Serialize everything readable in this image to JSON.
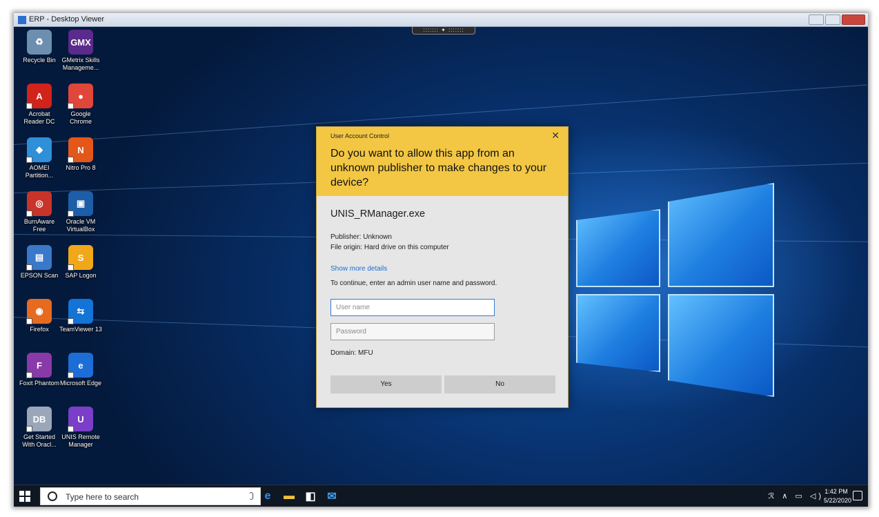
{
  "window": {
    "title": "ERP - Desktop Viewer",
    "connection_bar": "::::::: ✦ :::::::"
  },
  "desktop": {
    "icons": [
      {
        "name": "recycle-bin",
        "icon": "recycle-bin-icon",
        "label": "Recycle Bin",
        "glyph": "♻",
        "color": "#6c8fb0"
      },
      {
        "name": "gmetrix",
        "icon": "gmetrix-icon",
        "label": "GMetrix Skills Manageme...",
        "glyph": "GMX",
        "color": "#5a2a8c"
      },
      {
        "name": "acrobat",
        "icon": "acrobat-icon",
        "label": "Acrobat Reader DC",
        "glyph": "A",
        "color": "#d2231b"
      },
      {
        "name": "chrome",
        "icon": "chrome-icon",
        "label": "Google Chrome",
        "glyph": "●",
        "color": "#e0473a"
      },
      {
        "name": "aomei",
        "icon": "aomei-icon",
        "label": "AOMEI Partition...",
        "glyph": "◆",
        "color": "#2f8fd8"
      },
      {
        "name": "nitro",
        "icon": "nitro-icon",
        "label": "Nitro Pro 8",
        "glyph": "N",
        "color": "#e3571a"
      },
      {
        "name": "burnaware",
        "icon": "burnaware-icon",
        "label": "BurnAware Free",
        "glyph": "◎",
        "color": "#c8332a"
      },
      {
        "name": "virtualbox",
        "icon": "virtualbox-icon",
        "label": "Oracle VM VirtualBox",
        "glyph": "▣",
        "color": "#1d5ea8"
      },
      {
        "name": "epson-scan",
        "icon": "epson-scan-icon",
        "label": "EPSON Scan",
        "glyph": "▤",
        "color": "#3a78c9"
      },
      {
        "name": "sap-logon",
        "icon": "sap-logon-icon",
        "label": "SAP Logon",
        "glyph": "S",
        "color": "#f0a81a"
      },
      {
        "name": "firefox",
        "icon": "firefox-icon",
        "label": "Firefox",
        "glyph": "◉",
        "color": "#e66a1f"
      },
      {
        "name": "teamviewer",
        "icon": "teamviewer-icon",
        "label": "TeamViewer 13",
        "glyph": "⇆",
        "color": "#1373d6"
      },
      {
        "name": "foxit",
        "icon": "foxit-icon",
        "label": "Foxit Phantom",
        "glyph": "F",
        "color": "#8a3aa8"
      },
      {
        "name": "edge",
        "icon": "edge-icon",
        "label": "Microsoft Edge",
        "glyph": "e",
        "color": "#1c6ed6"
      },
      {
        "name": "oracle-start",
        "icon": "database-icon",
        "label": "Get Started With Oracl...",
        "glyph": "DB",
        "color": "#9aa7b8"
      },
      {
        "name": "unis-remote",
        "icon": "unis-remote-icon",
        "label": "UNIS Remote Manager",
        "glyph": "U",
        "color": "#7a3ec8"
      }
    ]
  },
  "uac_dialog": {
    "header_title": "User Account Control",
    "close_symbol": "✕",
    "question": "Do you want to allow this app from an unknown publisher to make changes to your device?",
    "app_name": "UNIS_RManager.exe",
    "publisher": "Publisher: Unknown",
    "file_origin": "File origin: Hard drive on this computer",
    "show_more_details": "Show more details",
    "instruction": "To continue, enter an admin user name and password.",
    "username_placeholder": "User name",
    "password_placeholder": "Password",
    "domain": "Domain: MFU",
    "yes_label": "Yes",
    "no_label": "No",
    "header_color": "#f3c743"
  },
  "taskbar": {
    "search_placeholder": "Type here to search",
    "time": "1:42 PM",
    "date": "5/22/2020",
    "tray_text": "ℛ ∧ ▭ ◁)",
    "pinned": [
      {
        "name": "task-view",
        "icon": "task-view-icon",
        "glyph": "⧉",
        "color": "#ffffff"
      },
      {
        "name": "edge",
        "icon": "edge-icon",
        "glyph": "e",
        "color": "#2f8ff0"
      },
      {
        "name": "file-explorer",
        "icon": "folder-icon",
        "glyph": "▬",
        "color": "#f2c13a"
      },
      {
        "name": "store",
        "icon": "store-icon",
        "glyph": "◧",
        "color": "#ffffff"
      },
      {
        "name": "mail",
        "icon": "mail-icon",
        "glyph": "✉",
        "color": "#3fa0f0"
      }
    ]
  }
}
